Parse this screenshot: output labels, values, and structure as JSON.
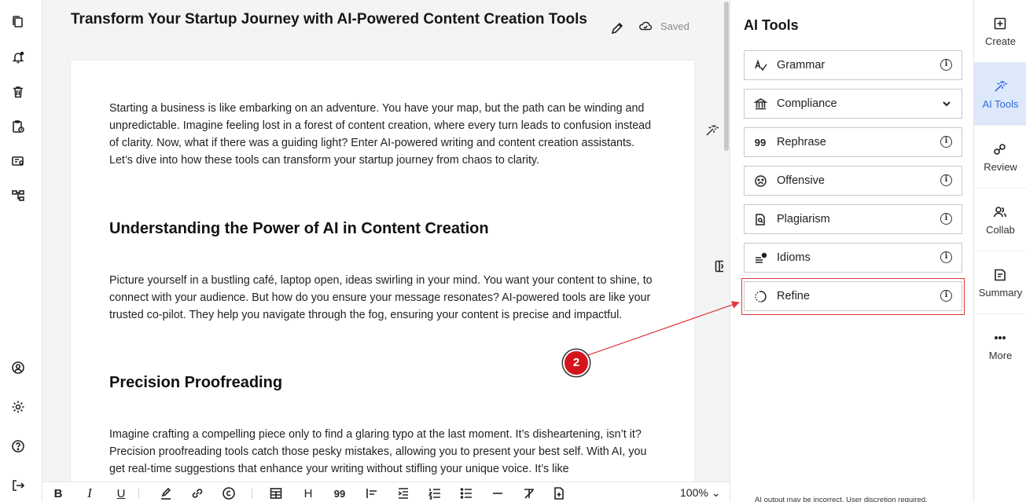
{
  "document": {
    "title": "Transform Your Startup Journey with AI-Powered Content Creation Tools",
    "save_status": "Saved",
    "paragraph_1": "Starting a business is like embarking on an adventure. You have your map, but the path can be winding and unpredictable. Imagine feeling lost in a forest of content creation, where every turn leads to confusion instead of clarity. Now, what if there was a guiding light? Enter AI-powered writing and content creation assistants. Let’s dive into how these tools can transform your startup journey from chaos to clarity.",
    "heading_1": "Understanding the Power of AI in Content Creation",
    "paragraph_2": "Picture yourself in a bustling café, laptop open, ideas swirling in your mind. You want your content to shine, to connect with your audience. But how do you ensure your message resonates? AI-powered tools are like your trusted co-pilot. They help you navigate through the fog, ensuring your content is precise and impactful.",
    "heading_2": "Precision Proofreading",
    "paragraph_3": "Imagine crafting a compelling piece only to find a glaring typo at the last moment. It’s disheartening, isn’t it? Precision proofreading tools catch those pesky mistakes, allowing you to present your best self. With AI, you get real-time suggestions that enhance your writing without stifling your unique voice. It’s like"
  },
  "toolbar": {
    "bold": "B",
    "italic": "I",
    "underline": "U",
    "heading": "H",
    "quote": "99",
    "zoom": "100%"
  },
  "ai_panel": {
    "title": "AI Tools",
    "tools": [
      {
        "label": "Grammar",
        "icon": "grammar-icon",
        "info": "i"
      },
      {
        "label": "Compliance",
        "icon": "bank-icon"
      },
      {
        "label": "Rephrase",
        "icon": "quote-icon",
        "info": "i"
      },
      {
        "label": "Offensive",
        "icon": "frown-face-icon",
        "info": "i"
      },
      {
        "label": "Plagiarism",
        "icon": "document-search-icon",
        "info": "i"
      },
      {
        "label": "Idioms",
        "icon": "idioms-icon",
        "info": "i"
      },
      {
        "label": "Refine",
        "icon": "refine-icon",
        "info": "i"
      }
    ],
    "disclaimer": "AI output may be incorrect. User discretion required."
  },
  "right_rail": {
    "items": [
      {
        "label": "Create",
        "icon": "plus-square-icon"
      },
      {
        "label": "AI Tools",
        "icon": "magic-wand-icon",
        "active": true
      },
      {
        "label": "Review",
        "icon": "review-icon"
      },
      {
        "label": "Collab",
        "icon": "people-icon"
      },
      {
        "label": "Summary",
        "icon": "summary-icon"
      },
      {
        "label": "More",
        "icon": "more-icon"
      }
    ]
  },
  "annotation": {
    "step": "2",
    "color": "#d4151b"
  },
  "colors": {
    "accent": "#2f68d8",
    "active_bg": "#dde8fb",
    "highlight": "#e0393e"
  }
}
